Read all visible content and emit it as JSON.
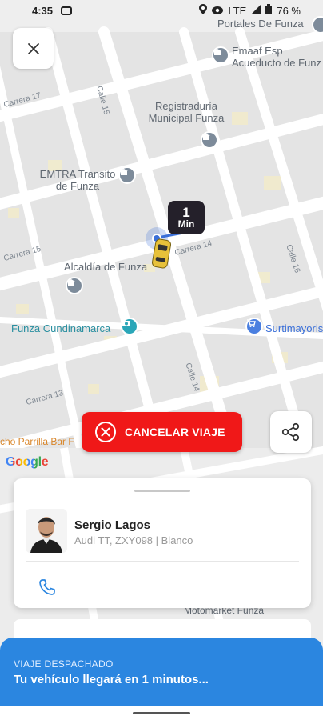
{
  "status_bar": {
    "time": "4:35",
    "network": "LTE",
    "battery": "76 %"
  },
  "map": {
    "labels": {
      "portales": "Portales De Funza",
      "emaaf": "Emaaf Esp Acueducto de Funz",
      "registraduria": "Registraduría Municipal Funza",
      "emtra": "EMTRA Transito de Funza",
      "alcaldia": "Alcaldía de Funza",
      "funza": "Funza Cundinamarca",
      "surtimayorista": "Surtimayoris",
      "parrilla": "cho Parrilla Bar F",
      "motomarket": "Motomarket Funza"
    },
    "streets": {
      "carrera17": "Carrera 17",
      "calle15": "Calle 15",
      "carrera15": "Carrera 15",
      "calle16": "Calle 16",
      "calle14": "Calle 14",
      "carrera13": "Carrera 13",
      "carrera14": "Carrera 14"
    }
  },
  "eta": {
    "value": "1",
    "unit": "Min"
  },
  "actions": {
    "cancel_label": "CANCELAR VIAJE"
  },
  "google": "Google",
  "driver": {
    "name": "Sergio Lagos",
    "vehicle": "Audi TT, ZXY098 | Blanco"
  },
  "trip_status": {
    "label": "VIAJE DESPACHADO",
    "message": "Tu vehículo llegará en 1 minutos..."
  },
  "colors": {
    "cancel": "#f01818",
    "status_panel": "#2b86e0",
    "eta_badge": "#24202a"
  }
}
